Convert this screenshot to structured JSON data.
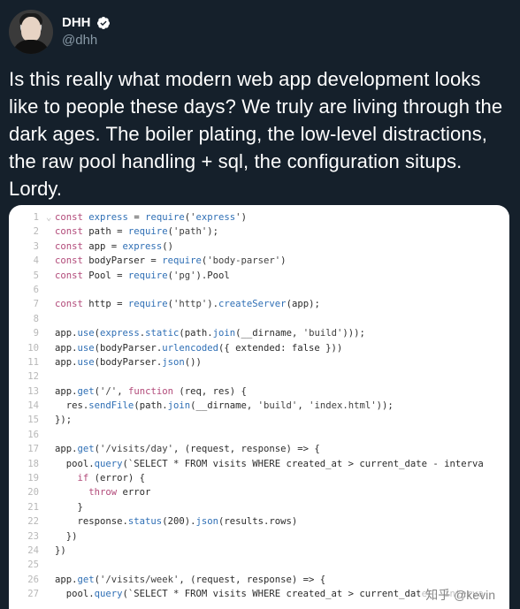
{
  "profile": {
    "display_name": "DHH",
    "handle": "@dhh",
    "verified_badge_color": "#1da1f2"
  },
  "tweet": {
    "text": "Is this really what modern web app development looks like to people these days? We truly are living through the dark ages. The boiler plating, the low-level distractions, the raw pool handling + sql, the configuration situps. Lordy."
  },
  "code_image": {
    "lines": [
      {
        "n": "1",
        "fold": "⌄",
        "code": "const express = require('express')"
      },
      {
        "n": "2",
        "fold": "",
        "code": "const path = require('path');"
      },
      {
        "n": "3",
        "fold": "",
        "code": "const app = express()"
      },
      {
        "n": "4",
        "fold": "",
        "code": "const bodyParser = require('body-parser')"
      },
      {
        "n": "5",
        "fold": "",
        "code": "const Pool = require('pg').Pool"
      },
      {
        "n": "6",
        "fold": "",
        "code": ""
      },
      {
        "n": "7",
        "fold": "",
        "code": "const http = require('http').createServer(app);"
      },
      {
        "n": "8",
        "fold": "",
        "code": ""
      },
      {
        "n": "9",
        "fold": "",
        "code": "app.use(express.static(path.join(__dirname, 'build')));"
      },
      {
        "n": "10",
        "fold": "",
        "code": "app.use(bodyParser.urlencoded({ extended: false }))"
      },
      {
        "n": "11",
        "fold": "",
        "code": "app.use(bodyParser.json())"
      },
      {
        "n": "12",
        "fold": "",
        "code": ""
      },
      {
        "n": "13",
        "fold": "",
        "code": "app.get('/', function (req, res) {"
      },
      {
        "n": "14",
        "fold": "",
        "code": "  res.sendFile(path.join(__dirname, 'build', 'index.html'));"
      },
      {
        "n": "15",
        "fold": "",
        "code": "});"
      },
      {
        "n": "16",
        "fold": "",
        "code": ""
      },
      {
        "n": "17",
        "fold": "",
        "code": "app.get('/visits/day', (request, response) => {"
      },
      {
        "n": "18",
        "fold": "",
        "code": "  pool.query(`SELECT * FROM visits WHERE created_at > current_date - interva"
      },
      {
        "n": "19",
        "fold": "",
        "code": "    if (error) {"
      },
      {
        "n": "20",
        "fold": "",
        "code": "      throw error"
      },
      {
        "n": "21",
        "fold": "",
        "code": "    }"
      },
      {
        "n": "22",
        "fold": "",
        "code": "    response.status(200).json(results.rows)"
      },
      {
        "n": "23",
        "fold": "",
        "code": "  })"
      },
      {
        "n": "24",
        "fold": "",
        "code": "})"
      },
      {
        "n": "25",
        "fold": "",
        "code": ""
      },
      {
        "n": "26",
        "fold": "",
        "code": "app.get('/visits/week', (request, response) => {"
      },
      {
        "n": "27",
        "fold": "",
        "code": "  pool.query(`SELECT * FROM visits WHERE created_at > current_date - interva"
      }
    ],
    "watermark": "知乎 @kevin"
  },
  "colors": {
    "background": "#15202b",
    "text_primary": "#ffffff",
    "text_secondary": "#8899a6",
    "code_bg": "#ffffff"
  }
}
